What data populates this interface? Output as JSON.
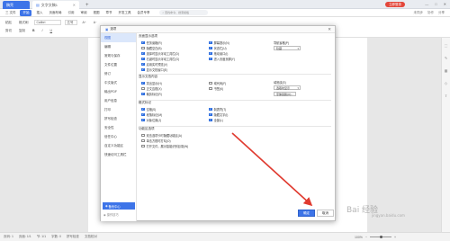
{
  "window": {
    "app_tab": "稿壳",
    "doc_tab": "文字文稿1",
    "new_tab": "+",
    "login": "立即登录",
    "controls": [
      "—",
      "□",
      "✕"
    ]
  },
  "menu": {
    "items": [
      "三 文件",
      "开始",
      "插入",
      "页面布局",
      "引用",
      "审阅",
      "视图",
      "章节",
      "开发工具",
      "会员专享"
    ],
    "active_index": 1,
    "search_placeholder": "查找命令、搜索模板",
    "right_items": [
      "未同步",
      "协作",
      "分享"
    ]
  },
  "toolbar": {
    "row1": [
      "粘贴",
      "格式刷",
      "Calibri",
      "五号",
      "A⁺",
      "A⁻",
      "B",
      "I",
      "U"
    ],
    "row2": [
      "剪切",
      "复制"
    ]
  },
  "status": {
    "page": "页码: 1",
    "pages": "页面: 1/1",
    "section": "节: 1/1",
    "words": "字数: 0",
    "spell": "拼写检查",
    "proof": "文档校对",
    "zoom": "100%"
  },
  "dialog": {
    "title": "选项",
    "close": "✕",
    "nav": [
      "视图",
      "编辑",
      "常规与保存",
      "文件位置",
      "修订",
      "中文版式",
      "输出PDF",
      "用户信息",
      "打印",
      "拼写检查",
      "安全性",
      "信任中心",
      "自定义功能区",
      "快速访问工具栏"
    ],
    "selected_nav": 0,
    "backup_label": "备份中心",
    "tips_label": "操作技巧",
    "ok": "确定",
    "cancel": "取消",
    "groups": {
      "page_display": {
        "title": "页面显示选项",
        "col1": [
          {
            "label": "任务窗格(R)",
            "checked": true
          },
          {
            "label": "隐藏空白(B)",
            "checked": false
          },
          {
            "label": "选择时显示浮动工具栏(D)",
            "checked": true
          },
          {
            "label": "右键时显示浮动工具栏(G)",
            "checked": true
          },
          {
            "label": "启用实时预览(V)",
            "checked": true
          },
          {
            "label": "显示文档窗口(E)",
            "checked": true
          }
        ],
        "col2": [
          {
            "label": "屏幕提示(N)",
            "checked": true
          },
          {
            "label": "状态栏(U)",
            "checked": true
          },
          {
            "label": "拖动窗口(I)",
            "checked": true
          },
          {
            "label": "进入页眉页脚(Y)",
            "checked": true
          },
          {
            "label": "进入页眉页脚(Y)",
            "checked": true
          }
        ],
        "nav_pane_label": "导航窗格(P)",
        "nav_pane_value": "隐藏"
      },
      "display_text": {
        "title": "显示文档内容",
        "col1": [
          {
            "label": "突出显示(H)",
            "checked": true
          },
          {
            "label": "正文边框(X)",
            "checked": false
          },
          {
            "label": "裁剪标记(R)",
            "checked": true
          }
        ],
        "col2": [
          {
            "label": "域代码(F)",
            "checked": false
          },
          {
            "label": "书签(K)",
            "checked": false
          }
        ],
        "field_shading_label": "域底纹(E)",
        "field_shading_value": "选取时显示",
        "font_button": "字体替换(O)..."
      },
      "format_marks": {
        "title": "格式标记",
        "col1": [
          {
            "label": "空格(S)",
            "checked": true
          },
          {
            "label": "段落标记(M)",
            "checked": true
          },
          {
            "label": "对象位置(J)",
            "checked": true
          }
        ],
        "col2": [
          {
            "label": "制表符(T)",
            "checked": true
          },
          {
            "label": "隐藏文字(I)",
            "checked": true
          },
          {
            "label": "全部(L)",
            "checked": true
          }
        ]
      },
      "feature_options": {
        "title": "功能区选项",
        "col1": [
          {
            "label": "双击选项卡时隐藏功能区(A)",
            "checked": false
          },
          {
            "label": "单击方框时打勾(O)",
            "checked": false
          },
          {
            "label": "打开文件，展示智能识别目录(W)",
            "checked": false
          }
        ]
      }
    }
  },
  "watermark": {
    "text": "Bai 经验",
    "sub": "jingyan.baidu.com"
  },
  "colors": {
    "accent": "#3d74e8",
    "arrow": "#e03a2f"
  }
}
